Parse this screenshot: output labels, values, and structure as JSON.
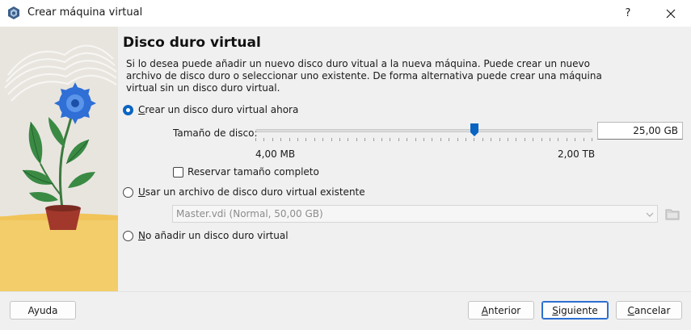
{
  "window": {
    "title": "Crear máquina virtual",
    "help_label": "?",
    "close_icon": "close-icon",
    "app_icon": "virtualbox-icon"
  },
  "page": {
    "heading": "Disco duro virtual",
    "description": "Si lo desea puede añadir un nuevo disco duro vitual a la nueva máquina. Puede crear un nuevo archivo de disco duro o seleccionar uno existente. De forma alternativa puede crear una máquina virtual sin un disco duro virtual."
  },
  "options": {
    "create_new": {
      "label": "Crear un disco duro virtual ahora",
      "checked": true
    },
    "use_existing": {
      "label": "Usar un archivo de disco duro virtual existente",
      "checked": false
    },
    "no_disk": {
      "label": "No añadir un disco duro virtual",
      "checked": false
    }
  },
  "disk_size": {
    "label": "Tamaño de disco:",
    "value": "25,00 GB",
    "min_label": "4,00 MB",
    "max_label": "2,00 TB",
    "slider_position_fraction": 0.65
  },
  "preallocate": {
    "label": "Reservar tamaño completo",
    "checked": false
  },
  "existing_file": {
    "selected": "Master.vdi (Normal, 50,00 GB)",
    "enabled": false,
    "browse_icon": "folder-icon"
  },
  "buttons": {
    "help": "Ayuda",
    "back": "Anterior",
    "next": "Siguiente",
    "cancel": "Cancelar"
  },
  "colors": {
    "accent": "#0a64c2",
    "default_button_border": "#2c6fd1",
    "panel_bg": "#f0f0f0"
  }
}
